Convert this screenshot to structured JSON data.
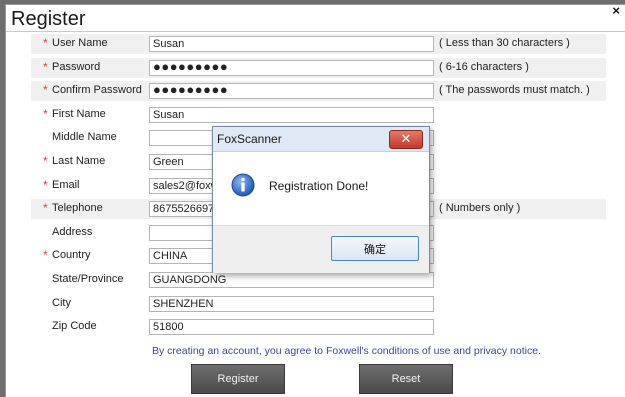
{
  "window": {
    "title": "Register",
    "close_glyph": "×"
  },
  "form": {
    "required_mark": "*",
    "fields": [
      {
        "label": "User Name",
        "required": true,
        "value": "Susan",
        "hint": "( Less than 30 characters )"
      },
      {
        "label": "Password",
        "required": true,
        "value": "●●●●●●●●●",
        "hint": "( 6-16 characters )"
      },
      {
        "label": "Confirm Password",
        "required": true,
        "value": "●●●●●●●●●",
        "hint": "( The passwords must match. )"
      },
      {
        "label": "First Name",
        "required": true,
        "value": "Susan",
        "hint": ""
      },
      {
        "label": "Middle Name",
        "required": false,
        "value": "",
        "hint": ""
      },
      {
        "label": "Last Name",
        "required": true,
        "value": "Green",
        "hint": ""
      },
      {
        "label": "Email",
        "required": true,
        "value": "sales2@foxw",
        "hint": ""
      },
      {
        "label": "Telephone",
        "required": true,
        "value": "86755266972",
        "hint": "( Numbers only )"
      },
      {
        "label": "Address",
        "required": false,
        "value": "",
        "hint": ""
      },
      {
        "label": "Country",
        "required": true,
        "value": "CHINA",
        "hint": ""
      },
      {
        "label": "State/Province",
        "required": false,
        "value": "GUANGDONG",
        "hint": ""
      },
      {
        "label": "City",
        "required": false,
        "value": "SHENZHEN",
        "hint": ""
      },
      {
        "label": "Zip Code",
        "required": false,
        "value": "51800",
        "hint": ""
      }
    ],
    "notice": "By creating an account, you agree to Foxwell's conditions of use and privacy notice.",
    "register_label": "Register",
    "reset_label": "Reset"
  },
  "dialog": {
    "title": "FoxScanner",
    "close_glyph": "✕",
    "message": "Registration Done!",
    "icon": "info-icon",
    "ok_label": "确定"
  },
  "colors": {
    "required": "#e33b3b",
    "notice": "#3a44a6",
    "dialog_button_border": "#4a84c8"
  }
}
